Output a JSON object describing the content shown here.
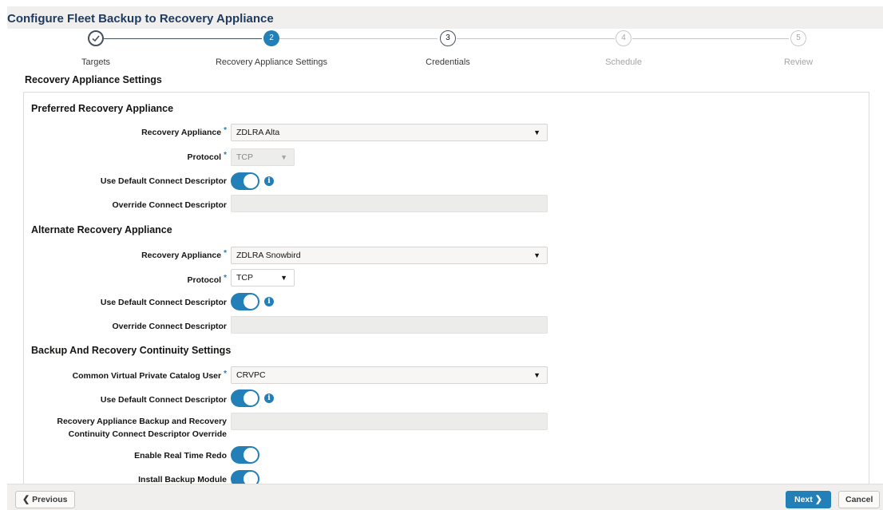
{
  "header": {
    "title": "Configure Fleet Backup to Recovery Appliance"
  },
  "train": {
    "steps": [
      {
        "number": "✓",
        "label": "Targets"
      },
      {
        "number": "2",
        "label": "Recovery Appliance Settings"
      },
      {
        "number": "3",
        "label": "Credentials"
      },
      {
        "number": "4",
        "label": "Schedule"
      },
      {
        "number": "5",
        "label": "Review"
      }
    ]
  },
  "section_title": "Recovery Appliance Settings",
  "preferred": {
    "heading": "Preferred Recovery Appliance",
    "appliance_label": "Recovery Appliance",
    "appliance_value": "ZDLRA Alta",
    "protocol_label": "Protocol",
    "protocol_value": "TCP",
    "use_default_label": "Use Default Connect Descriptor",
    "override_label": "Override Connect Descriptor"
  },
  "alternate": {
    "heading": "Alternate Recovery Appliance",
    "appliance_label": "Recovery Appliance",
    "appliance_value": "ZDLRA Snowbird",
    "protocol_label": "Protocol",
    "protocol_value": "TCP",
    "use_default_label": "Use Default Connect Descriptor",
    "override_label": "Override Connect Descriptor"
  },
  "continuity": {
    "heading": "Backup And Recovery Continuity Settings",
    "catalog_user_label": "Common Virtual Private Catalog User",
    "catalog_user_value": "CRVPC",
    "use_default_label": "Use Default Connect Descriptor",
    "override_label_line1": "Recovery Appliance Backup and Recovery",
    "override_label_line2": "Continuity Connect Descriptor Override",
    "real_time_redo_label": "Enable Real Time Redo",
    "install_module_label": "Install Backup Module"
  },
  "required_mark": "*",
  "info_glyph": "i",
  "footer": {
    "previous_label": "Previous",
    "next_label": "Next",
    "cancel_label": "Cancel"
  },
  "colors": {
    "accent": "#227fb7",
    "title": "#1e3a5f"
  },
  "icons": {
    "done": "check-icon",
    "caret": "caret-down-icon",
    "info": "info-icon",
    "prev": "chevron-left-icon",
    "next": "chevron-right-icon"
  }
}
